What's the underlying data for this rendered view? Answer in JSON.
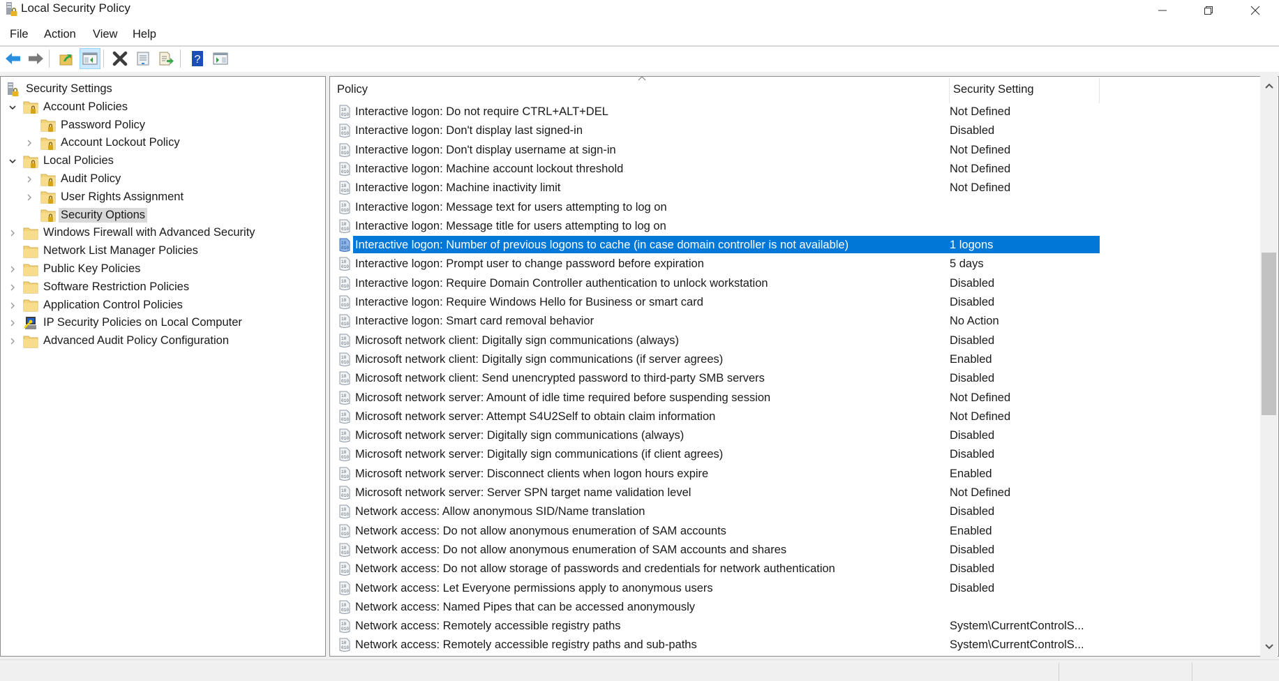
{
  "window": {
    "title": "Local Security Policy",
    "app_icon": "security-policy-icon",
    "controls": [
      "minimize",
      "restore",
      "close"
    ]
  },
  "menu": {
    "items": [
      {
        "label": "File"
      },
      {
        "label": "Action"
      },
      {
        "label": "View"
      },
      {
        "label": "Help"
      }
    ]
  },
  "toolbar": {
    "buttons": [
      {
        "name": "back",
        "icon": "back-arrow-icon",
        "color": "#2b8fe0"
      },
      {
        "name": "forward",
        "icon": "forward-arrow-icon",
        "color": "#7a7a7a"
      },
      {
        "name": "up-one-level",
        "icon": "folder-up-icon"
      },
      {
        "name": "show-hide-console-tree",
        "icon": "console-tree-icon",
        "active": true
      },
      {
        "name": "delete",
        "icon": "delete-x-icon"
      },
      {
        "name": "properties",
        "icon": "properties-icon"
      },
      {
        "name": "export-list",
        "icon": "export-list-icon"
      },
      {
        "name": "help",
        "icon": "help-icon",
        "color": "#1a4fb5"
      },
      {
        "name": "show-hide-action-pane",
        "icon": "action-pane-icon"
      }
    ]
  },
  "tree": {
    "items": [
      {
        "label": "Security Settings",
        "icon": "security-settings-icon",
        "level": 0,
        "expander": "none"
      },
      {
        "label": "Account Policies",
        "icon": "locked-folder-icon",
        "level": 1,
        "expander": "expanded"
      },
      {
        "label": "Password Policy",
        "icon": "locked-folder-icon",
        "level": 2,
        "expander": "none"
      },
      {
        "label": "Account Lockout Policy",
        "icon": "locked-folder-icon",
        "level": 2,
        "expander": "collapsed"
      },
      {
        "label": "Local Policies",
        "icon": "locked-folder-icon",
        "level": 1,
        "expander": "expanded"
      },
      {
        "label": "Audit Policy",
        "icon": "locked-folder-icon",
        "level": 2,
        "expander": "collapsed"
      },
      {
        "label": "User Rights Assignment",
        "icon": "locked-folder-icon",
        "level": 2,
        "expander": "collapsed"
      },
      {
        "label": "Security Options",
        "icon": "locked-folder-icon",
        "level": 2,
        "expander": "none",
        "selected": true
      },
      {
        "label": "Windows Firewall with Advanced Security",
        "icon": "folder-icon",
        "level": 1,
        "expander": "collapsed"
      },
      {
        "label": "Network List Manager Policies",
        "icon": "folder-icon",
        "level": 1,
        "expander": "none"
      },
      {
        "label": "Public Key Policies",
        "icon": "folder-icon",
        "level": 1,
        "expander": "collapsed"
      },
      {
        "label": "Software Restriction Policies",
        "icon": "folder-icon",
        "level": 1,
        "expander": "collapsed"
      },
      {
        "label": "Application Control Policies",
        "icon": "folder-icon",
        "level": 1,
        "expander": "collapsed"
      },
      {
        "label": "IP Security Policies on Local Computer",
        "icon": "ip-security-icon",
        "level": 1,
        "expander": "collapsed"
      },
      {
        "label": "Advanced Audit Policy Configuration",
        "icon": "folder-icon",
        "level": 1,
        "expander": "collapsed"
      }
    ]
  },
  "list": {
    "columns": [
      {
        "label": "Policy",
        "sorted": "ascending"
      },
      {
        "label": "Security Setting"
      }
    ],
    "selection_color": "#0078d7",
    "rows": [
      {
        "policy": "Interactive logon: Do not require CTRL+ALT+DEL",
        "setting": "Not Defined"
      },
      {
        "policy": "Interactive logon: Don't display last signed-in",
        "setting": "Disabled"
      },
      {
        "policy": "Interactive logon: Don't display username at sign-in",
        "setting": "Not Defined"
      },
      {
        "policy": "Interactive logon: Machine account lockout threshold",
        "setting": "Not Defined"
      },
      {
        "policy": "Interactive logon: Machine inactivity limit",
        "setting": "Not Defined"
      },
      {
        "policy": "Interactive logon: Message text for users attempting to log on",
        "setting": ""
      },
      {
        "policy": "Interactive logon: Message title for users attempting to log on",
        "setting": ""
      },
      {
        "policy": "Interactive logon: Number of previous logons to cache (in case domain controller is not available)",
        "setting": "1 logons",
        "selected": true
      },
      {
        "policy": "Interactive logon: Prompt user to change password before expiration",
        "setting": "5 days"
      },
      {
        "policy": "Interactive logon: Require Domain Controller authentication to unlock workstation",
        "setting": "Disabled"
      },
      {
        "policy": "Interactive logon: Require Windows Hello for Business or smart card",
        "setting": "Disabled"
      },
      {
        "policy": "Interactive logon: Smart card removal behavior",
        "setting": "No Action"
      },
      {
        "policy": "Microsoft network client: Digitally sign communications (always)",
        "setting": "Disabled"
      },
      {
        "policy": "Microsoft network client: Digitally sign communications (if server agrees)",
        "setting": "Enabled"
      },
      {
        "policy": "Microsoft network client: Send unencrypted password to third-party SMB servers",
        "setting": "Disabled"
      },
      {
        "policy": "Microsoft network server: Amount of idle time required before suspending session",
        "setting": "Not Defined"
      },
      {
        "policy": "Microsoft network server: Attempt S4U2Self to obtain claim information",
        "setting": "Not Defined"
      },
      {
        "policy": "Microsoft network server: Digitally sign communications (always)",
        "setting": "Disabled"
      },
      {
        "policy": "Microsoft network server: Digitally sign communications (if client agrees)",
        "setting": "Disabled"
      },
      {
        "policy": "Microsoft network server: Disconnect clients when logon hours expire",
        "setting": "Enabled"
      },
      {
        "policy": "Microsoft network server: Server SPN target name validation level",
        "setting": "Not Defined"
      },
      {
        "policy": "Network access: Allow anonymous SID/Name translation",
        "setting": "Disabled"
      },
      {
        "policy": "Network access: Do not allow anonymous enumeration of SAM accounts",
        "setting": "Enabled"
      },
      {
        "policy": "Network access: Do not allow anonymous enumeration of SAM accounts and shares",
        "setting": "Disabled"
      },
      {
        "policy": "Network access: Do not allow storage of passwords and credentials for network authentication",
        "setting": "Disabled"
      },
      {
        "policy": "Network access: Let Everyone permissions apply to anonymous users",
        "setting": "Disabled"
      },
      {
        "policy": "Network access: Named Pipes that can be accessed anonymously",
        "setting": ""
      },
      {
        "policy": "Network access: Remotely accessible registry paths",
        "setting": "System\\CurrentControlS..."
      },
      {
        "policy": "Network access: Remotely accessible registry paths and sub-paths",
        "setting": "System\\CurrentControlS..."
      }
    ]
  },
  "scrollbar": {
    "position_fraction": 0.29,
    "visible_fraction": 0.3
  },
  "statusbar": {
    "segments": [
      "",
      "",
      ""
    ]
  }
}
